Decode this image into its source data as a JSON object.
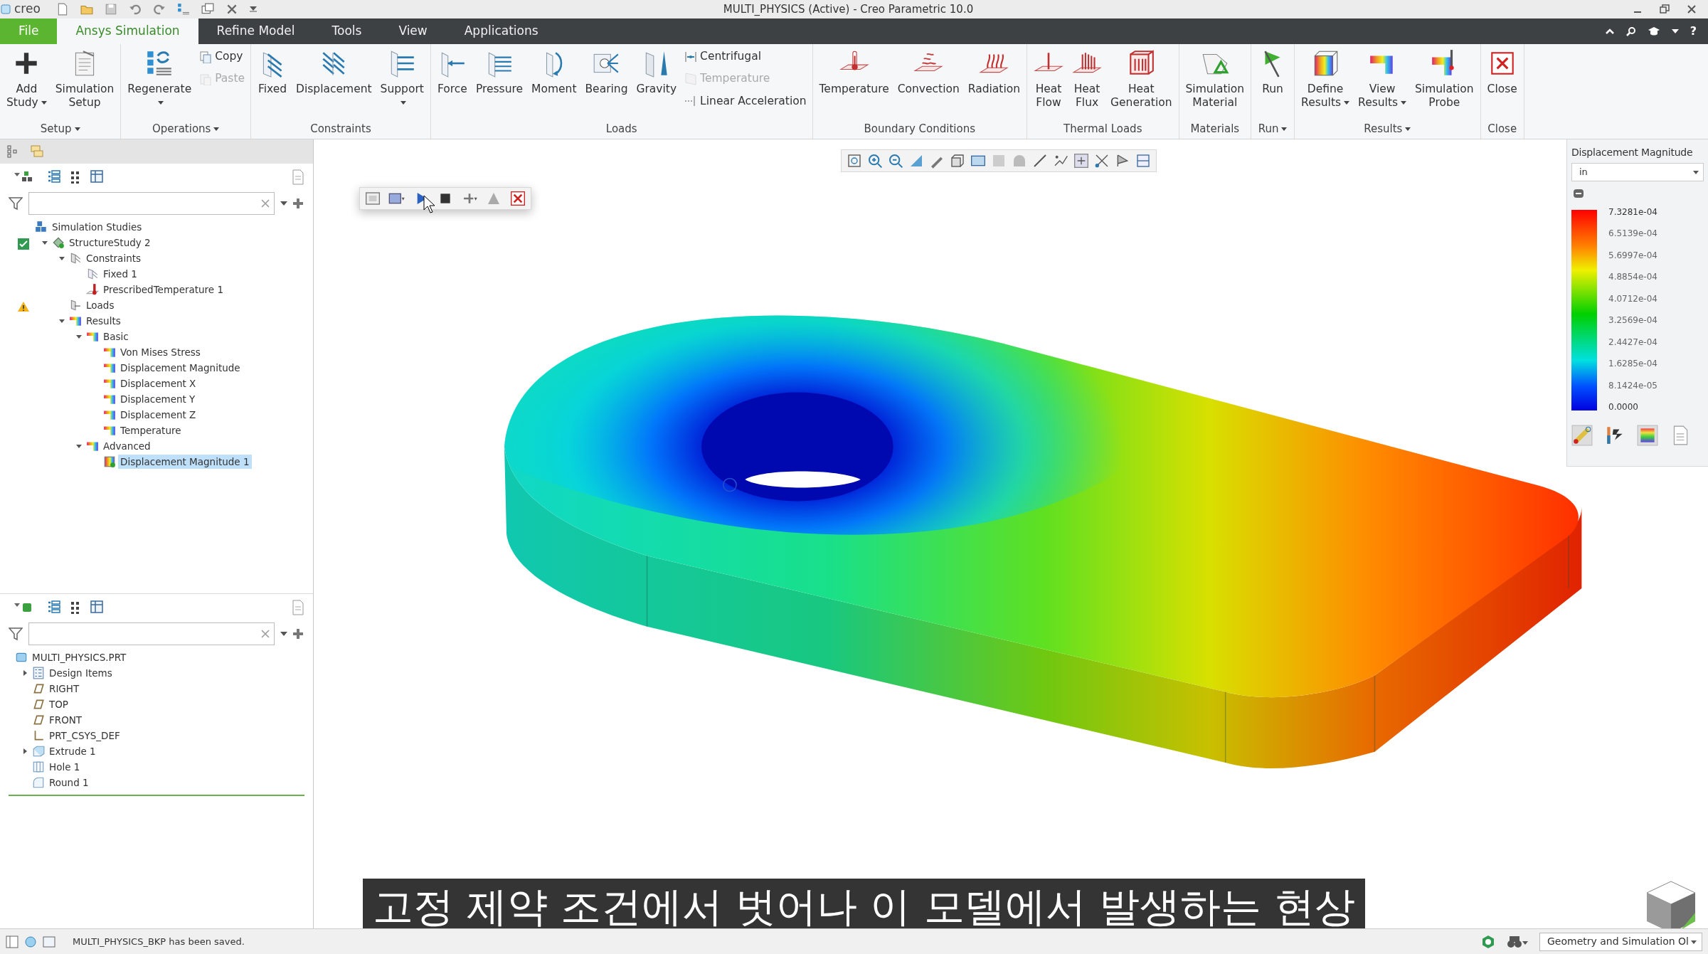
{
  "window": {
    "logo": "creo",
    "title": "MULTI_PHYSICS (Active) - Creo Parametric 10.0"
  },
  "tabs": [
    {
      "label": "File",
      "kind": "file",
      "selected": false
    },
    {
      "label": "Ansys Simulation",
      "kind": "tab",
      "selected": true
    },
    {
      "label": "Refine Model",
      "kind": "tab",
      "selected": false
    },
    {
      "label": "Tools",
      "kind": "tab",
      "selected": false
    },
    {
      "label": "View",
      "kind": "tab",
      "selected": false
    },
    {
      "label": "Applications",
      "kind": "tab",
      "selected": false
    }
  ],
  "help": "?",
  "ribbon": {
    "groups": [
      {
        "label": "Setup",
        "dropdown": true,
        "items": [
          {
            "label": "Add\nStudy",
            "kind": "add",
            "small": false,
            "dropdown": true,
            "disabled": false
          },
          {
            "label": "Simulation\nSetup",
            "kind": "setup",
            "small": false,
            "dropdown": false,
            "disabled": false
          }
        ]
      },
      {
        "label": "Operations",
        "dropdown": true,
        "items": [
          {
            "label": "Regenerate",
            "kind": "regenerate",
            "small": false,
            "dropdown": true,
            "disabled": false
          },
          {
            "label": "Copy",
            "kind": "copy",
            "small": true,
            "dropdown": false,
            "disabled": false
          },
          {
            "label": "Paste",
            "kind": "paste",
            "small": true,
            "dropdown": false,
            "disabled": true
          }
        ]
      },
      {
        "label": "Constraints",
        "dropdown": false,
        "items": [
          {
            "label": "Fixed",
            "kind": "fixed",
            "small": false,
            "dropdown": false,
            "disabled": false
          },
          {
            "label": "Displacement",
            "kind": "displacement",
            "small": false,
            "dropdown": false,
            "disabled": false
          },
          {
            "label": "Support",
            "kind": "support",
            "small": false,
            "dropdown": true,
            "disabled": false
          }
        ]
      },
      {
        "label": "Loads",
        "dropdown": false,
        "items": [
          {
            "label": "Force",
            "kind": "force",
            "small": false,
            "dropdown": false,
            "disabled": false
          },
          {
            "label": "Pressure",
            "kind": "pressure",
            "small": false,
            "dropdown": false,
            "disabled": false
          },
          {
            "label": "Moment",
            "kind": "moment",
            "small": false,
            "dropdown": false,
            "disabled": false
          },
          {
            "label": "Bearing",
            "kind": "bearing",
            "small": false,
            "dropdown": false,
            "disabled": false
          },
          {
            "label": "Gravity",
            "kind": "gravity",
            "small": false,
            "dropdown": false,
            "disabled": false
          },
          {
            "label": "Centrifugal",
            "kind": "centrifugal",
            "small": true,
            "dropdown": false,
            "disabled": false
          },
          {
            "label": "Temperature",
            "kind": "temp-small",
            "small": true,
            "dropdown": false,
            "disabled": true
          },
          {
            "label": "Linear Acceleration",
            "kind": "accel",
            "small": true,
            "dropdown": false,
            "disabled": false
          }
        ]
      },
      {
        "label": "Boundary Conditions",
        "dropdown": false,
        "items": [
          {
            "label": "Temperature",
            "kind": "thermometer",
            "small": false,
            "dropdown": false,
            "disabled": false
          },
          {
            "label": "Convection",
            "kind": "convection",
            "small": false,
            "dropdown": false,
            "disabled": false
          },
          {
            "label": "Radiation",
            "kind": "radiation",
            "small": false,
            "dropdown": false,
            "disabled": false
          }
        ]
      },
      {
        "label": "Thermal Loads",
        "dropdown": false,
        "items": [
          {
            "label": "Heat\nFlow",
            "kind": "heatflow",
            "small": false,
            "dropdown": false,
            "disabled": false
          },
          {
            "label": "Heat\nFlux",
            "kind": "heatflux",
            "small": false,
            "dropdown": false,
            "disabled": false
          },
          {
            "label": "Heat\nGeneration",
            "kind": "heatgen",
            "small": false,
            "dropdown": false,
            "disabled": false
          }
        ]
      },
      {
        "label": "Materials",
        "dropdown": false,
        "items": [
          {
            "label": "Simulation\nMaterial",
            "kind": "material",
            "small": false,
            "dropdown": false,
            "disabled": false
          }
        ]
      },
      {
        "label": "Run",
        "dropdown": true,
        "items": [
          {
            "label": "Run",
            "kind": "run",
            "small": false,
            "dropdown": false,
            "disabled": false
          }
        ]
      },
      {
        "label": "Results",
        "dropdown": true,
        "items": [
          {
            "label": "Define\nResults",
            "kind": "define",
            "small": false,
            "dropdown": true,
            "disabled": false
          },
          {
            "label": "View\nResults",
            "kind": "view",
            "small": false,
            "dropdown": true,
            "disabled": false
          },
          {
            "label": "Simulation\nProbe",
            "kind": "probe",
            "small": false,
            "dropdown": false,
            "disabled": false
          }
        ]
      },
      {
        "label": "Close",
        "dropdown": false,
        "items": [
          {
            "label": "Close",
            "kind": "close",
            "small": false,
            "dropdown": false,
            "disabled": false
          }
        ]
      }
    ]
  },
  "simulation_tree": {
    "items": [
      {
        "label": "Simulation Studies",
        "kind": "studies",
        "selected": false,
        "children": [
          {
            "label": "StructureStudy 2",
            "kind": "study",
            "checked": true,
            "expanded": true,
            "selected": false,
            "children": [
              {
                "label": "Constraints",
                "kind": "constraints",
                "expanded": true,
                "selected": false,
                "children": [
                  {
                    "label": "Fixed 1",
                    "kind": "fixed",
                    "selected": false
                  },
                  {
                    "label": "PrescribedTemperature 1",
                    "kind": "temperature",
                    "selected": false
                  }
                ]
              },
              {
                "label": "Loads",
                "kind": "loads",
                "warning": true,
                "selected": false
              },
              {
                "label": "Results",
                "kind": "result",
                "expanded": true,
                "selected": false,
                "children": [
                  {
                    "label": "Basic",
                    "kind": "result",
                    "expanded": true,
                    "selected": false,
                    "children": [
                      {
                        "label": "Von Mises Stress",
                        "kind": "result",
                        "selected": false
                      },
                      {
                        "label": "Displacement Magnitude",
                        "kind": "result",
                        "selected": false
                      },
                      {
                        "label": "Displacement X",
                        "kind": "result",
                        "selected": false
                      },
                      {
                        "label": "Displacement Y",
                        "kind": "result",
                        "selected": false
                      },
                      {
                        "label": "Displacement Z",
                        "kind": "result",
                        "selected": false
                      },
                      {
                        "label": "Temperature",
                        "kind": "result",
                        "selected": false
                      }
                    ]
                  },
                  {
                    "label": "Advanced",
                    "kind": "result",
                    "expanded": true,
                    "selected": false,
                    "children": [
                      {
                        "label": "Displacement Magnitude 1",
                        "kind": "result-custom",
                        "selected": true
                      }
                    ]
                  }
                ]
              }
            ]
          }
        ]
      }
    ]
  },
  "model_tree": {
    "items": [
      {
        "label": "MULTI_PHYSICS.PRT",
        "kind": "part",
        "selected": false,
        "children": [
          {
            "label": "Design Items",
            "kind": "list",
            "expanded": false,
            "selected": false
          },
          {
            "label": "RIGHT",
            "kind": "plane",
            "selected": false
          },
          {
            "label": "TOP",
            "kind": "plane",
            "selected": false
          },
          {
            "label": "FRONT",
            "kind": "plane",
            "selected": false
          },
          {
            "label": "PRT_CSYS_DEF",
            "kind": "csys",
            "selected": false
          },
          {
            "label": "Extrude 1",
            "kind": "extrude",
            "expanded": false,
            "selected": false
          },
          {
            "label": "Hole 1",
            "kind": "hole",
            "selected": false
          },
          {
            "label": "Round 1",
            "kind": "round",
            "selected": false
          }
        ]
      }
    ]
  },
  "legend": {
    "title": "Displacement Magnitude",
    "unit": "in",
    "values": [
      "7.3281e-04",
      "6.5139e-04",
      "5.6997e-04",
      "4.8854e-04",
      "4.0712e-04",
      "3.2569e-04",
      "2.4427e-04",
      "1.6285e-04",
      "8.1424e-05",
      "0.0000"
    ]
  },
  "caption": "고정 제약 조건에서 벗어나 이 모델에서 발생하는 현상",
  "status_bar": {
    "message": "MULTI_PHYSICS_BKP has been saved.",
    "selection_filter": "Geometry and Simulation Ol"
  }
}
